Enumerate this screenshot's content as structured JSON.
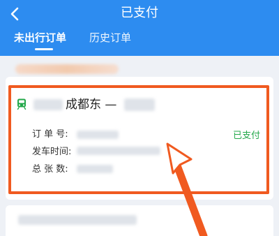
{
  "header": {
    "title": "已支付",
    "back_icon": "back-chevron-icon",
    "tabs": [
      {
        "label": "未出行订单",
        "active": true
      },
      {
        "label": "历史订单",
        "active": false
      }
    ]
  },
  "order_card": {
    "train_icon": "train-icon",
    "route_station": "成都东 —",
    "fields": [
      {
        "label": "订 单 号:"
      },
      {
        "label": "发车时间:"
      },
      {
        "label": "总 张 数:"
      }
    ],
    "status": "已支付"
  },
  "colors": {
    "header_blue": "#2d8cf0",
    "highlight_orange": "#f05a20",
    "status_green": "#24a84b"
  }
}
